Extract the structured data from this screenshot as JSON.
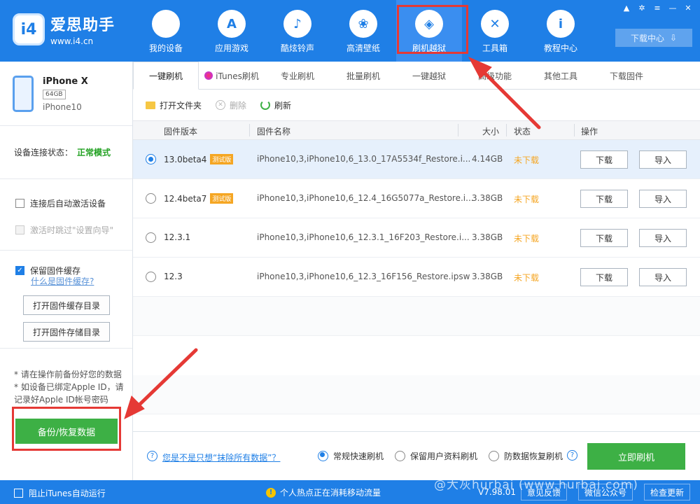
{
  "app": {
    "logo_mark": "i4",
    "name": "爱思助手",
    "url": "www.i4.cn"
  },
  "nav": [
    {
      "label": "我的设备",
      "icon": "apple-icon",
      "glyph": ""
    },
    {
      "label": "应用游戏",
      "icon": "app-store-icon",
      "glyph": "A"
    },
    {
      "label": "酷炫铃声",
      "icon": "bell-icon",
      "glyph": "♪"
    },
    {
      "label": "高清壁纸",
      "icon": "flower-icon",
      "glyph": "❀"
    },
    {
      "label": "刷机越狱",
      "icon": "dropbox-icon",
      "glyph": "◈"
    },
    {
      "label": "工具箱",
      "icon": "tools-icon",
      "glyph": "✕"
    },
    {
      "label": "教程中心",
      "icon": "info-icon",
      "glyph": "i"
    }
  ],
  "download_center": "下载中心",
  "device": {
    "name": "iPhone X",
    "capacity": "64GB",
    "model": "iPhone10"
  },
  "connection": {
    "label": "设备连接状态：",
    "value": "正常模式"
  },
  "options": {
    "auto_activate": "连接后自动激活设备",
    "skip_setup": "激活时跳过\"设置向导\"",
    "keep_cache": "保留固件缓存",
    "what_is_cache": "什么是固件缓存?",
    "open_cache_dir": "打开固件缓存目录",
    "open_storage_dir": "打开固件存储目录"
  },
  "notes": {
    "line1": "* 请在操作前备份好您的数据",
    "line2": "* 如设备已绑定Apple ID，请记录好Apple ID帐号密码"
  },
  "backup_button": "备份/恢复数据",
  "tabs": [
    "一键刷机",
    "iTunes刷机",
    "专业刷机",
    "批量刷机",
    "一键越狱",
    "高级功能",
    "其他工具",
    "下载固件"
  ],
  "toolbar": {
    "open_folder": "打开文件夹",
    "delete": "删除",
    "refresh": "刷新"
  },
  "table": {
    "headers": {
      "version": "固件版本",
      "name": "固件名称",
      "size": "大小",
      "status": "状态",
      "action": "操作"
    },
    "beta_tag": "测试版",
    "download_label": "下载",
    "import_label": "导入",
    "rows": [
      {
        "version": "13.0beta4",
        "beta": true,
        "name": "iPhone10,3,iPhone10,6_13.0_17A5534f_Restore.i...",
        "size": "4.14GB",
        "status": "未下载",
        "selected": true
      },
      {
        "version": "12.4beta7",
        "beta": true,
        "name": "iPhone10,3,iPhone10,6_12.4_16G5077a_Restore.i...",
        "size": "3.38GB",
        "status": "未下载",
        "selected": false
      },
      {
        "version": "12.3.1",
        "beta": false,
        "name": "iPhone10,3,iPhone10,6_12.3.1_16F203_Restore.i...",
        "size": "3.38GB",
        "status": "未下载",
        "selected": false
      },
      {
        "version": "12.3",
        "beta": false,
        "name": "iPhone10,3,iPhone10,6_12.3_16F156_Restore.ipsw",
        "size": "3.38GB",
        "status": "未下载",
        "selected": false
      }
    ]
  },
  "bottom": {
    "erase_link": "您是不是只想“抹除所有数据”？",
    "mode_fast": "常规快速刷机",
    "mode_keep": "保留用户资料刷机",
    "mode_recover": "防数据恢复刷机",
    "flash_button": "立即刷机"
  },
  "statusbar": {
    "block_itunes": "阻止iTunes自动运行",
    "hotspot": "个人热点正在消耗移动流量",
    "version": "V7.98.01",
    "feedback": "意见反馈",
    "wechat": "微信公众号",
    "update": "检查更新"
  },
  "watermark": "@大灰hurbai (www.hurbai.com)",
  "colors": {
    "brand_blue": "#1f7fe6",
    "green": "#3db045",
    "orange": "#f5a623",
    "highlight_red": "#e53935"
  }
}
